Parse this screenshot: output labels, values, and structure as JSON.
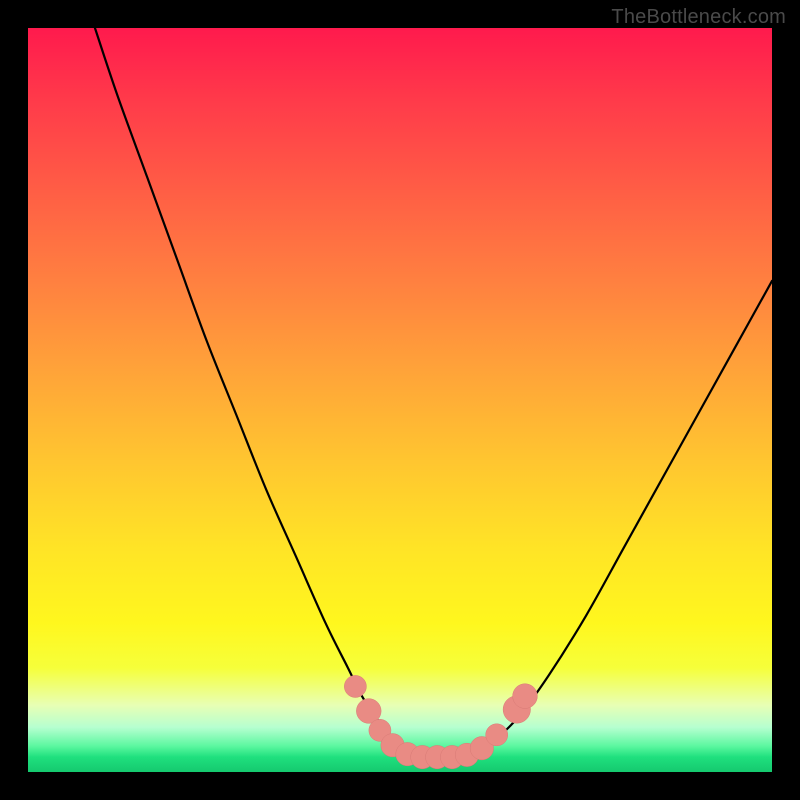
{
  "watermark": "TheBottleneck.com",
  "colors": {
    "frame": "#000000",
    "curve": "#000000",
    "marker_fill": "#e98b84",
    "marker_stroke": "#d97b76"
  },
  "chart_data": {
    "type": "line",
    "title": "",
    "xlabel": "",
    "ylabel": "",
    "xlim": [
      0,
      100
    ],
    "ylim": [
      0,
      100
    ],
    "series": [
      {
        "name": "bottleneck-curve",
        "x": [
          9,
          12,
          16,
          20,
          24,
          28,
          32,
          36,
          40,
          43,
          45,
          47,
          49,
          51,
          53,
          55,
          57,
          59,
          61,
          63,
          66,
          70,
          75,
          80,
          85,
          90,
          95,
          100
        ],
        "y": [
          100,
          91,
          80,
          69,
          58,
          48,
          38,
          29,
          20,
          14,
          10,
          7,
          4.5,
          3,
          2.2,
          2,
          2,
          2.2,
          3,
          4.5,
          7.5,
          13,
          21,
          30,
          39,
          48,
          57,
          66
        ]
      }
    ],
    "markers": [
      {
        "x": 44.0,
        "y": 11.5,
        "r": 1.2
      },
      {
        "x": 45.8,
        "y": 8.2,
        "r": 1.4
      },
      {
        "x": 47.3,
        "y": 5.6,
        "r": 1.2
      },
      {
        "x": 49.0,
        "y": 3.6,
        "r": 1.3
      },
      {
        "x": 51.0,
        "y": 2.4,
        "r": 1.3
      },
      {
        "x": 53.0,
        "y": 2.0,
        "r": 1.3
      },
      {
        "x": 55.0,
        "y": 2.0,
        "r": 1.3
      },
      {
        "x": 57.0,
        "y": 2.0,
        "r": 1.3
      },
      {
        "x": 59.0,
        "y": 2.3,
        "r": 1.3
      },
      {
        "x": 61.0,
        "y": 3.2,
        "r": 1.3
      },
      {
        "x": 63.0,
        "y": 5.0,
        "r": 1.2
      },
      {
        "x": 65.7,
        "y": 8.4,
        "r": 1.6
      },
      {
        "x": 66.8,
        "y": 10.2,
        "r": 1.4
      }
    ]
  }
}
